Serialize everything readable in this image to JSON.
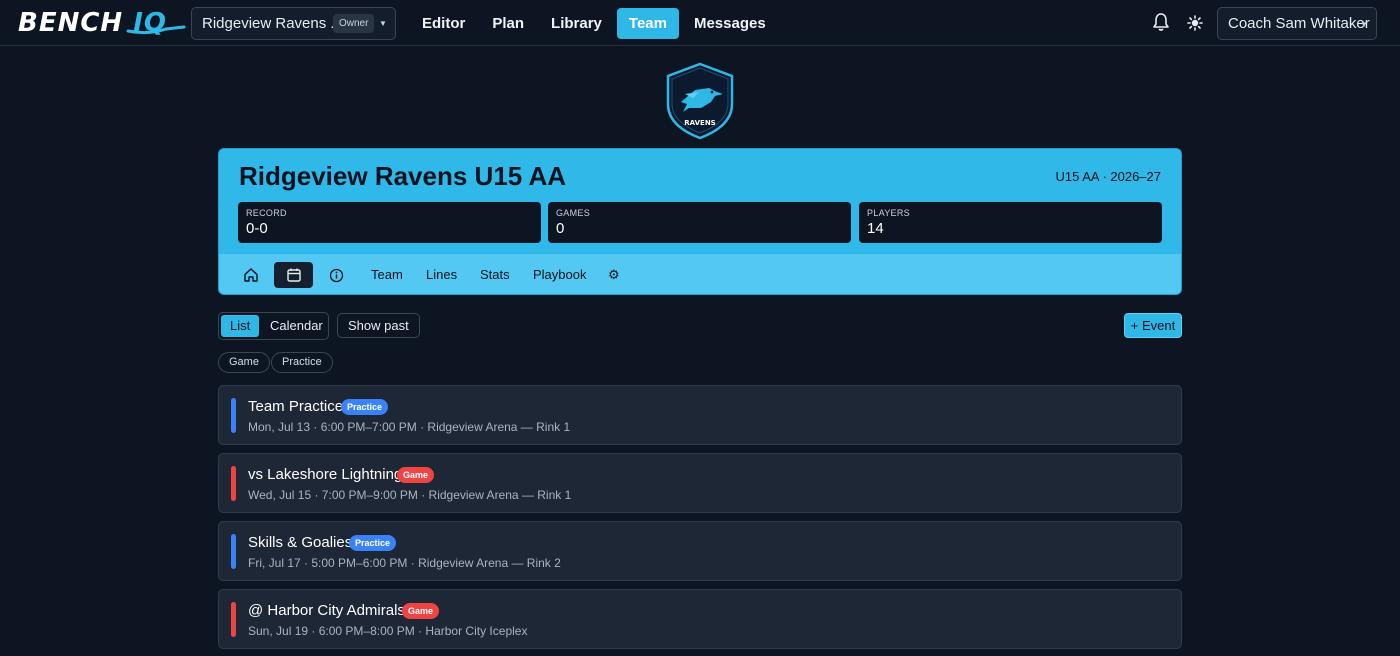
{
  "brand": {
    "name_part1": "BENCH ",
    "name_part2": "IQ"
  },
  "team_switcher": {
    "name": "Ridgeview Ravens ...",
    "role": "Owner"
  },
  "nav": [
    {
      "label": "Editor"
    },
    {
      "label": "Plan"
    },
    {
      "label": "Library"
    },
    {
      "label": "Team",
      "active": true
    },
    {
      "label": "Messages"
    }
  ],
  "user_menu": {
    "name": "Coach Sam Whitaker"
  },
  "crest": {
    "text": "RAVENS"
  },
  "team_card": {
    "title": "Ridgeview Ravens U15 AA",
    "season": "U15 AA · 2026–27",
    "stats": [
      {
        "label": "RECORD",
        "value": "0-0"
      },
      {
        "label": "GAMES",
        "value": "0"
      },
      {
        "label": "PLAYERS",
        "value": "14"
      }
    ],
    "tabs": [
      "Team",
      "Lines",
      "Stats",
      "Playbook"
    ]
  },
  "view_toggle": {
    "list": "List",
    "calendar": "Calendar",
    "active": "List"
  },
  "show_past": "Show past",
  "add_event": "+ Event",
  "filters": [
    "Game",
    "Practice"
  ],
  "events": [
    {
      "title": "Team Practice",
      "type": "Practice",
      "details": "Mon, Jul 13 · 6:00 PM–7:00 PM · Ridgeview Arena — Rink 1"
    },
    {
      "title": "vs Lakeshore Lightning",
      "type": "Game",
      "details": "Wed, Jul 15 · 7:00 PM–9:00 PM · Ridgeview Arena — Rink 1"
    },
    {
      "title": "Skills & Goalies",
      "type": "Practice",
      "details": "Fri, Jul 17 · 5:00 PM–6:00 PM · Ridgeview Arena — Rink 2"
    },
    {
      "title": "@ Harbor City Admirals",
      "type": "Game",
      "details": "Sun, Jul 19 · 6:00 PM–8:00 PM · Harbor City Iceplex"
    }
  ],
  "colors": {
    "accent": "#2fb7e6",
    "practice": "#3b82f6",
    "game": "#ef4444"
  }
}
